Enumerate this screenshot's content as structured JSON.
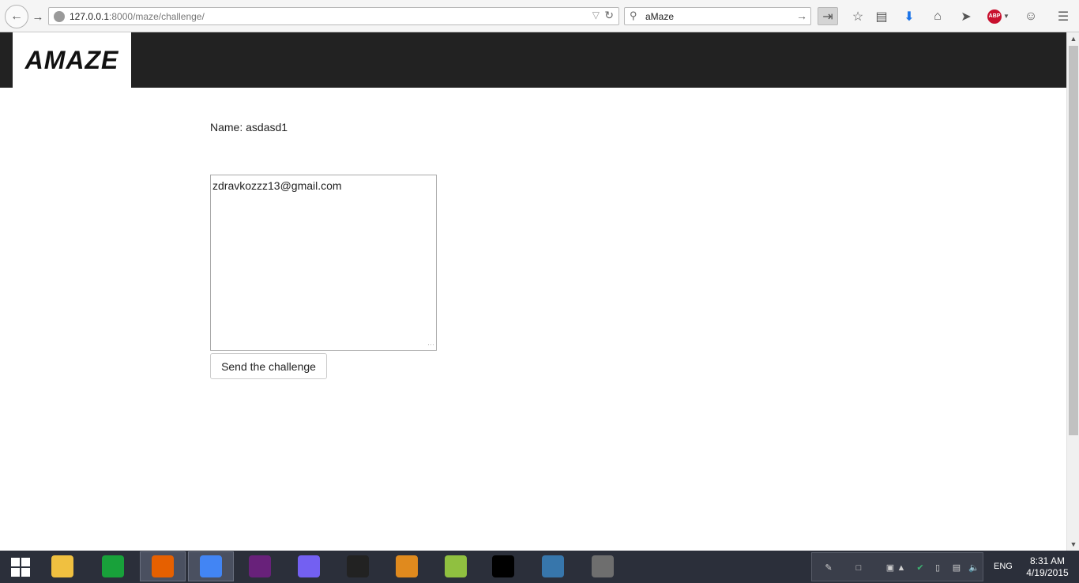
{
  "browser": {
    "url_host": "127.0.0.1",
    "url_rest": ":8000/maze/challenge/",
    "search_text": "aMaze",
    "abp_label": "ABP"
  },
  "page": {
    "logo_text": "AMAZE",
    "name_line": "Name: asdasd1",
    "email_value": "zdravkozzz13@gmail.com",
    "send_button_label": "Send the challenge"
  },
  "taskbar": {
    "apps": [
      {
        "name": "file-explorer-icon",
        "color": "#f0c040"
      },
      {
        "name": "store-icon",
        "color": "#18a13a"
      },
      {
        "name": "firefox-icon",
        "color": "#e66000"
      },
      {
        "name": "chrome-icon",
        "color": "#4285f4"
      },
      {
        "name": "visual-studio-icon",
        "color": "#68217a"
      },
      {
        "name": "viber-icon",
        "color": "#7360f2"
      },
      {
        "name": "unity-icon",
        "color": "#222222"
      },
      {
        "name": "eclipse-icon",
        "color": "#e08a1e"
      },
      {
        "name": "notepad-plus-plus-icon",
        "color": "#90c040"
      },
      {
        "name": "command-prompt-icon",
        "color": "#000000"
      },
      {
        "name": "python-icon",
        "color": "#3776ab"
      },
      {
        "name": "gimp-icon",
        "color": "#6e6e6e"
      }
    ],
    "language": "ENG",
    "time": "8:31 AM",
    "date": "4/19/2015"
  }
}
